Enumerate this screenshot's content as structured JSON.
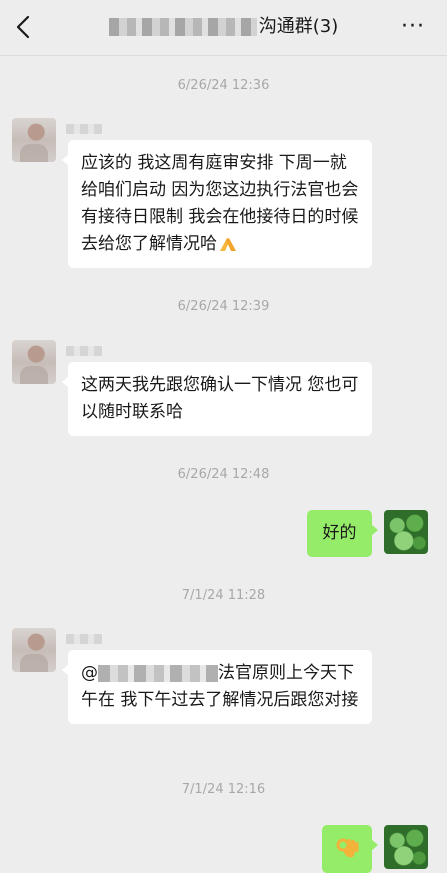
{
  "header": {
    "title_suffix": "沟通群(3)",
    "more_label": "···",
    "back_icon": "chevron-left-icon"
  },
  "messages": [
    {
      "type": "time",
      "text": "6/26/24 12:36"
    },
    {
      "type": "incoming",
      "text": "应该的 我这周有庭审安排 下周一就给咱们启动 因为您这边执行法官也会有接待日限制 我会在他接待日的时候去给您了解情况哈🙏"
    },
    {
      "type": "time",
      "text": "6/26/24 12:39"
    },
    {
      "type": "incoming",
      "text": "这两天我先跟您确认一下情况 您也可以随时联系哈"
    },
    {
      "type": "time",
      "text": "6/26/24 12:48"
    },
    {
      "type": "outgoing",
      "text": "好的"
    },
    {
      "type": "time",
      "text": "7/1/24 11:28"
    },
    {
      "type": "incoming",
      "prefix": "@",
      "text": "法官原则上今天下午在 我下午过去了解情况后跟您对接"
    },
    {
      "type": "time",
      "text": "7/1/24 12:16"
    },
    {
      "type": "outgoing",
      "emoji": "ok-hand"
    }
  ],
  "colors": {
    "background": "#ededed",
    "incoming_bubble": "#ffffff",
    "outgoing_bubble": "#95ec69",
    "timestamp": "#a8a8a8"
  }
}
